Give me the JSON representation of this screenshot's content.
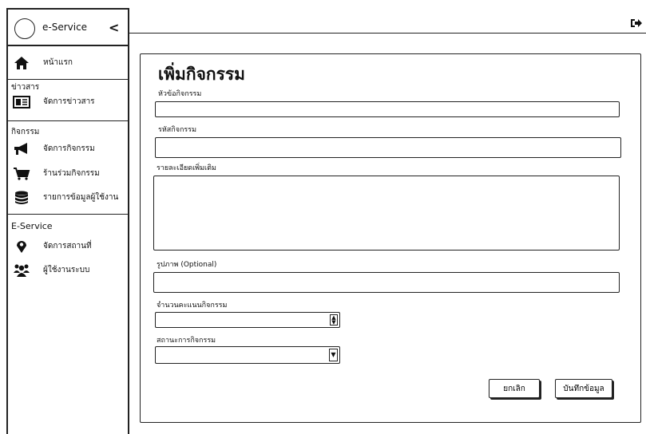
{
  "app": {
    "name": "e-Service",
    "collapse_glyph": "<"
  },
  "sidebar": {
    "home": {
      "label": "หน้าแรก",
      "icon": "home-icon"
    },
    "news_section": "ข่าวสาร",
    "news_items": [
      {
        "label": "จัดการข่าวสาร",
        "icon": "newspaper-icon"
      }
    ],
    "activity_section": "กิจกรรม",
    "activity_items": [
      {
        "label": "จัดการกิจกรรม",
        "icon": "megaphone-icon"
      },
      {
        "label": "ร้านร่วมกิจกรรม",
        "icon": "cart-icon"
      },
      {
        "label": "รายการข้อมูลผู้ใช้งาน",
        "icon": "database-icon"
      }
    ],
    "eservice_section": "E-Service",
    "eservice_items": [
      {
        "label": "จัดการสถานที่",
        "icon": "map-marker-icon"
      },
      {
        "label": "ผู้ใช้งานระบบ",
        "icon": "users-icon"
      }
    ]
  },
  "header": {
    "logout_icon": "logout-icon"
  },
  "form": {
    "title": "เพิ่มกิจกรรม",
    "fields": {
      "topic": {
        "label": "หัวข้อกิจกรรม",
        "value": ""
      },
      "code": {
        "label": "รหัสกิจกรรม",
        "value": ""
      },
      "details": {
        "label": "รายละเอียดเพิ่มเติม",
        "value": ""
      },
      "image": {
        "label": "รูปภาพ (Optional)",
        "value": ""
      },
      "points": {
        "label": "จำนวนคะแนนกิจกรรม",
        "value": ""
      },
      "status": {
        "label": "สถานะการกิจกรรม",
        "value": ""
      }
    },
    "cancel_label": "ยกเลิก",
    "save_label": "บันทึกข้อมูล"
  },
  "colors": {
    "stroke": "#222222",
    "background": "#ffffff"
  }
}
